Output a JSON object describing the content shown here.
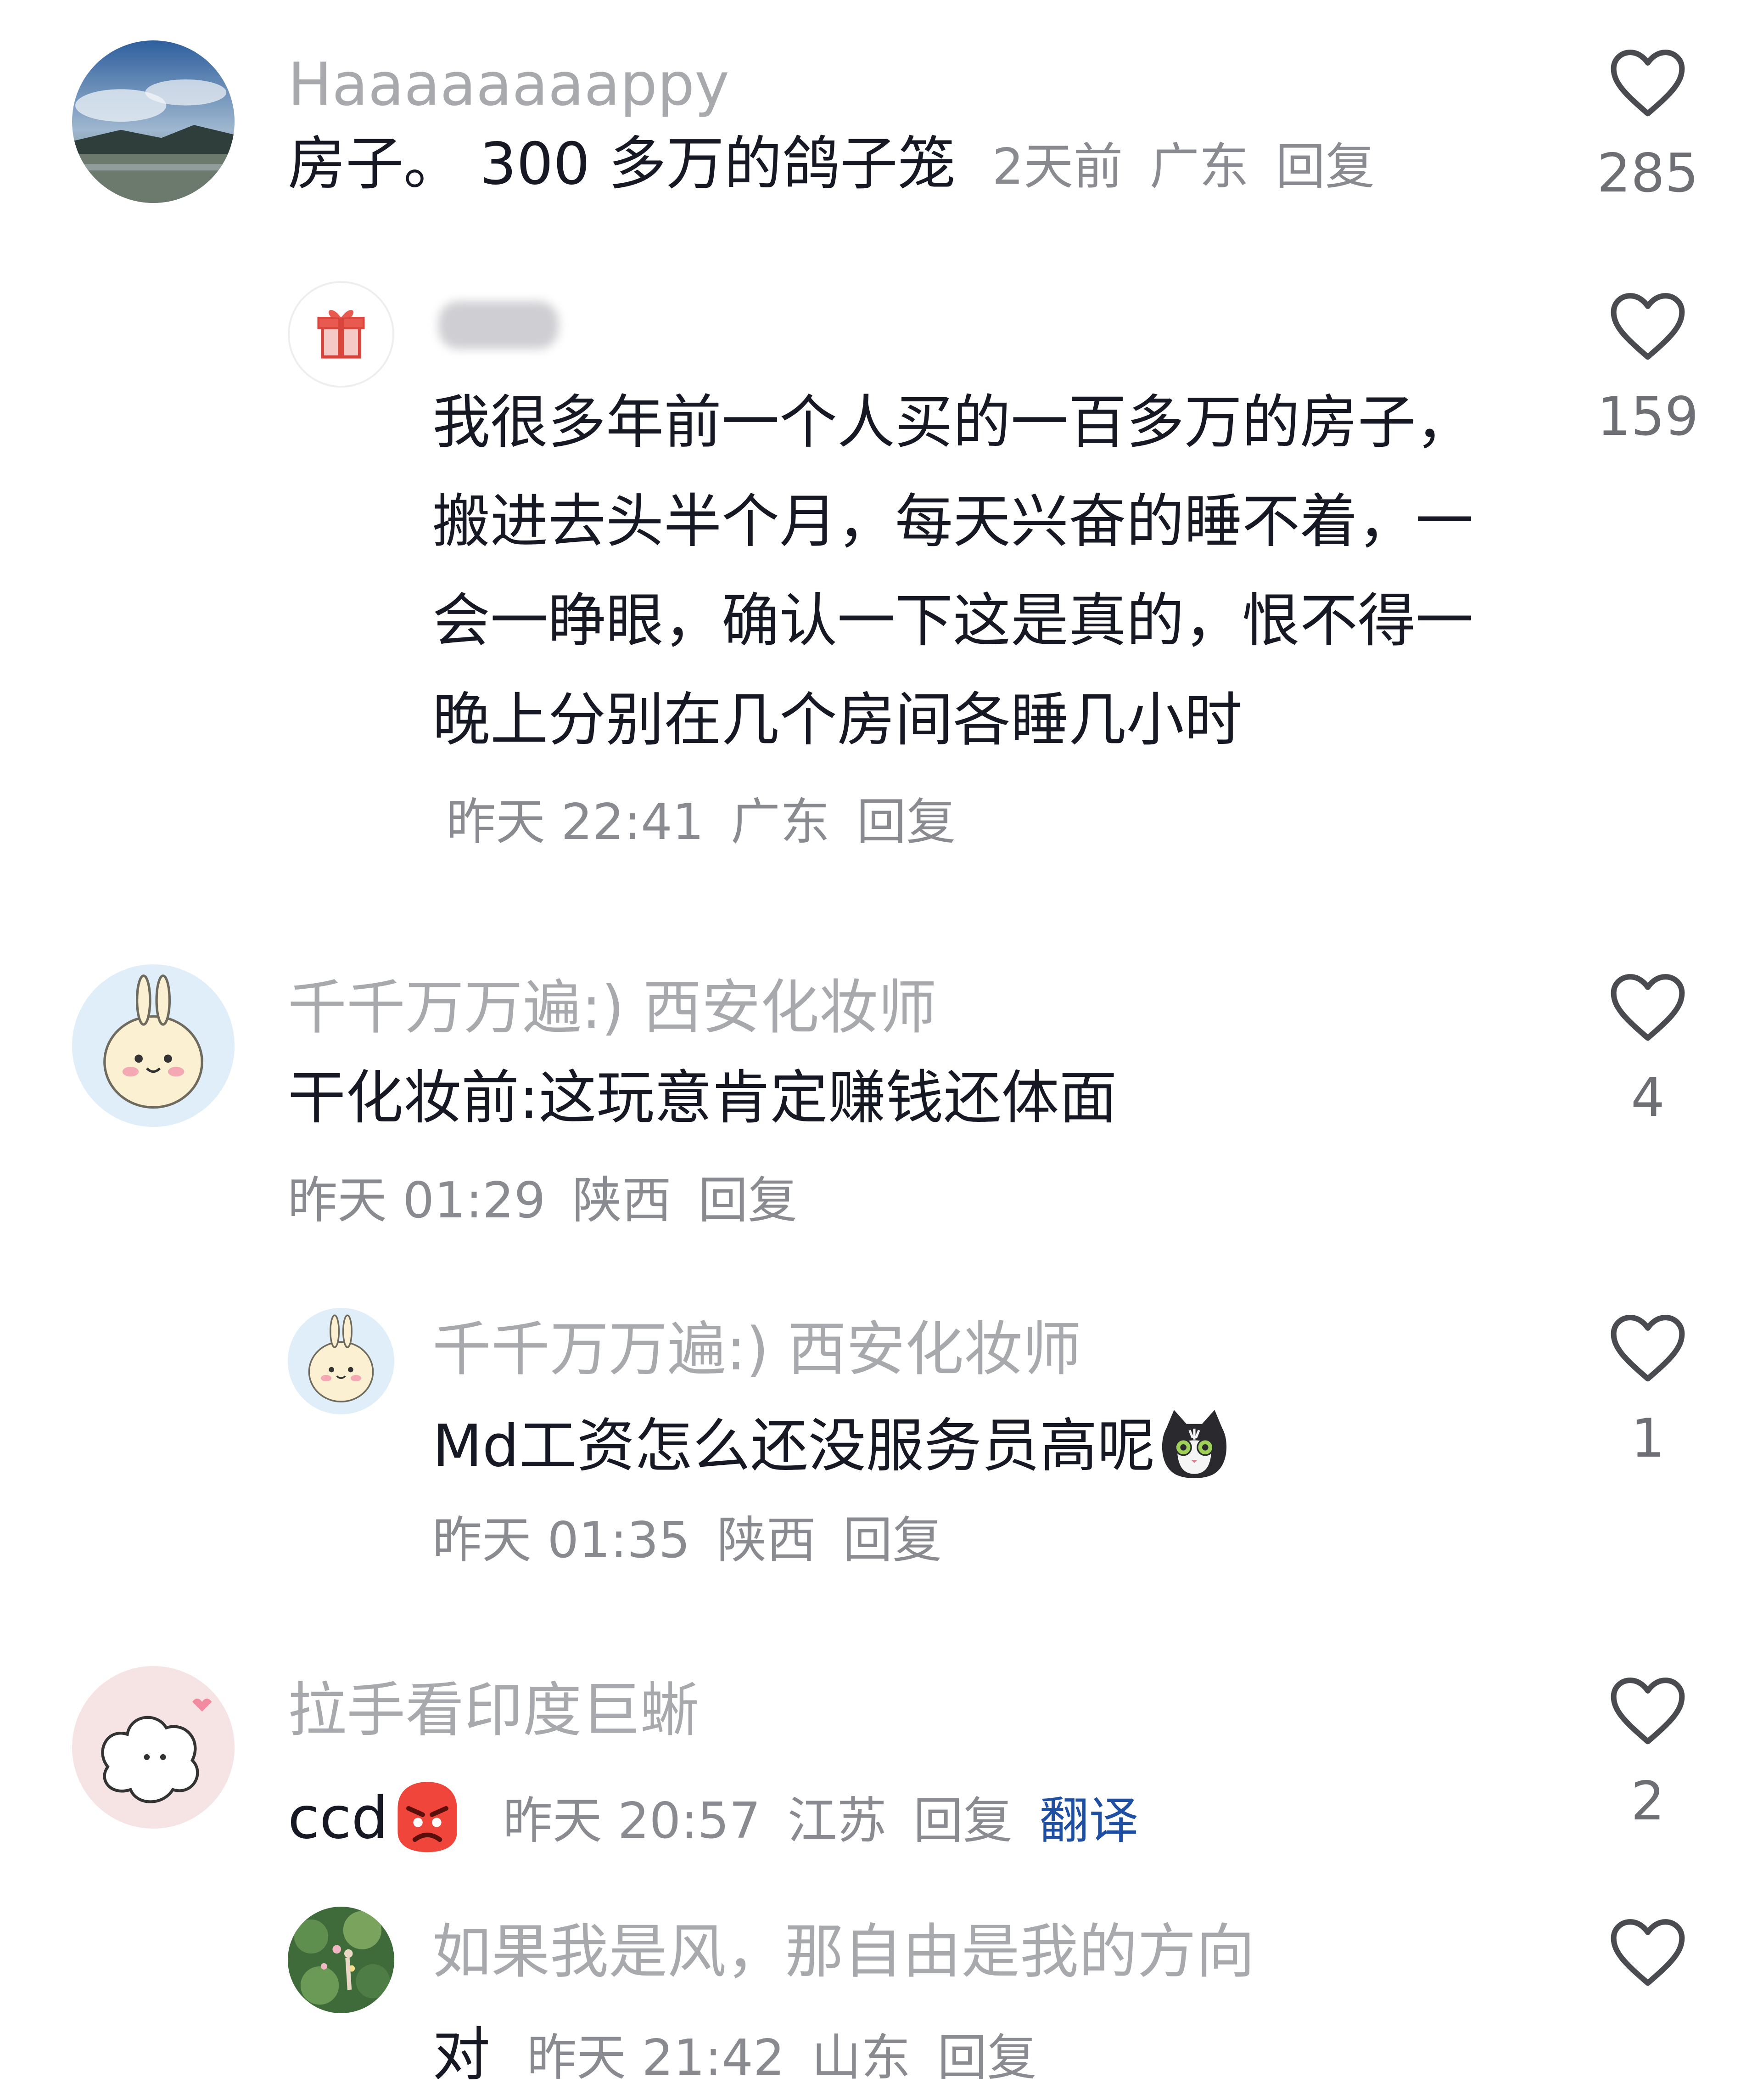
{
  "comments": [
    {
      "username": "Haaaaaaaappy",
      "content": "房子。 300 多万的鸽子笼",
      "time": "2天前",
      "location": "广东",
      "reply": "回复",
      "likes": "285"
    },
    {
      "username": "",
      "content": "我很多年前一个人买的一百多万的房子，搬进去头半个月，每天兴奋的睡不着，一会一睁眼，确认一下这是真的，恨不得一晚上分别在几个房间各睡几小时",
      "time": "昨天 22:41",
      "location": "广东",
      "reply": "回复",
      "likes": "159"
    },
    {
      "username": "千千万万遍:) 西安化妆师",
      "content": "干化妆前:这玩意肯定赚钱还体面",
      "time": "昨天 01:29",
      "location": "陕西",
      "reply": "回复",
      "likes": "4"
    },
    {
      "username": "千千万万遍:) 西安化妆师",
      "content": "Md工资怎么还没服务员高呢",
      "time": "昨天 01:35",
      "location": "陕西",
      "reply": "回复",
      "likes": "1"
    },
    {
      "username": "拉手看印度巨蜥",
      "content": "ccd",
      "time": "昨天 20:57",
      "location": "江苏",
      "reply": "回复",
      "translate": "翻译",
      "likes": "2"
    },
    {
      "username": "如果我是风，那自由是我的方向",
      "content": "对",
      "time": "昨天 21:42",
      "location": "山东",
      "reply": "回复",
      "likes": ""
    }
  ],
  "icons": {
    "like": "heart-outline-icon",
    "gift": "gift-icon",
    "cat_emoji": "cat-face-emoji",
    "angry_emoji": "angry-face-emoji"
  },
  "colors": {
    "text_primary": "#161823",
    "text_secondary": "#8a8b91",
    "username": "#a8a9ad",
    "translate": "#1f4fa3"
  }
}
